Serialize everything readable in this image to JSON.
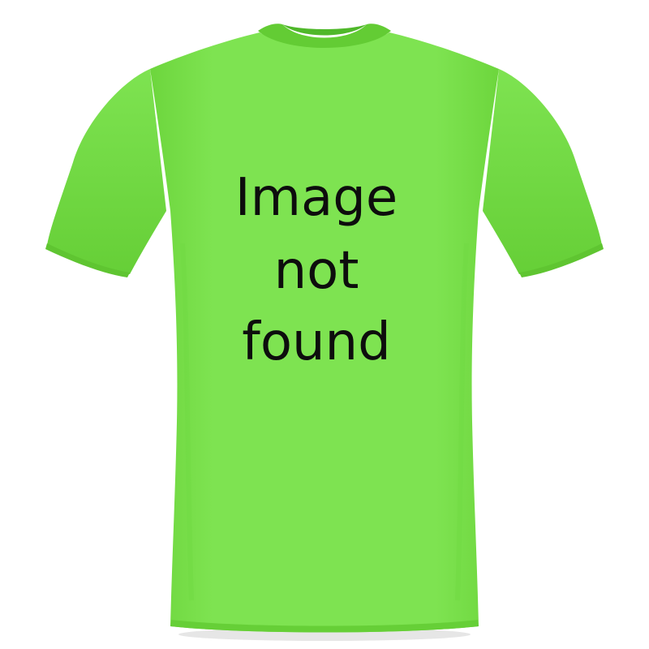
{
  "product": {
    "garment": "t-shirt",
    "color": "#7ee351",
    "print_lines": [
      "Image",
      "not",
      "found"
    ]
  }
}
